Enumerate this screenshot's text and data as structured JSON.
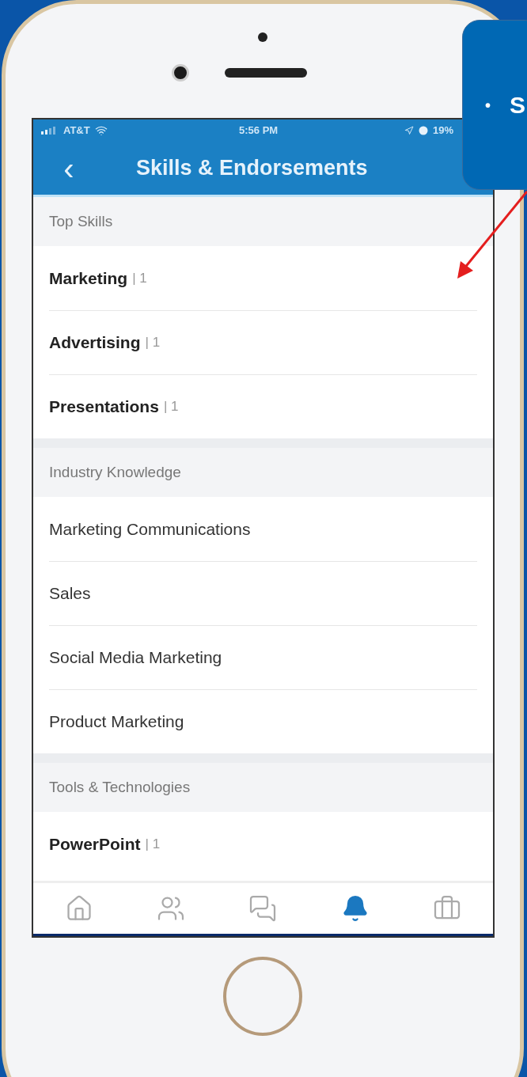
{
  "callout": {
    "bullet": "•",
    "text": "S"
  },
  "status_bar": {
    "carrier": "AT&T",
    "time": "5:56 PM",
    "battery": "19%"
  },
  "nav": {
    "back": "‹",
    "title": "Skills & Endorsements"
  },
  "sections": [
    {
      "title": "Top Skills",
      "skills": [
        {
          "name": "Marketing",
          "count": "| 1"
        },
        {
          "name": "Advertising",
          "count": "| 1"
        },
        {
          "name": "Presentations",
          "count": "| 1"
        }
      ]
    },
    {
      "title": "Industry Knowledge",
      "skills": [
        {
          "name": "Marketing Communications"
        },
        {
          "name": "Sales"
        },
        {
          "name": "Social Media Marketing"
        },
        {
          "name": "Product Marketing"
        }
      ]
    },
    {
      "title": "Tools & Technologies",
      "skills": [
        {
          "name": "PowerPoint",
          "count": "| 1"
        }
      ]
    }
  ],
  "tab_bar": [
    {
      "kind": "home",
      "selected": false
    },
    {
      "kind": "people",
      "selected": false
    },
    {
      "kind": "messages",
      "selected": false
    },
    {
      "kind": "notifications",
      "selected": true
    },
    {
      "kind": "jobs",
      "selected": false
    }
  ]
}
